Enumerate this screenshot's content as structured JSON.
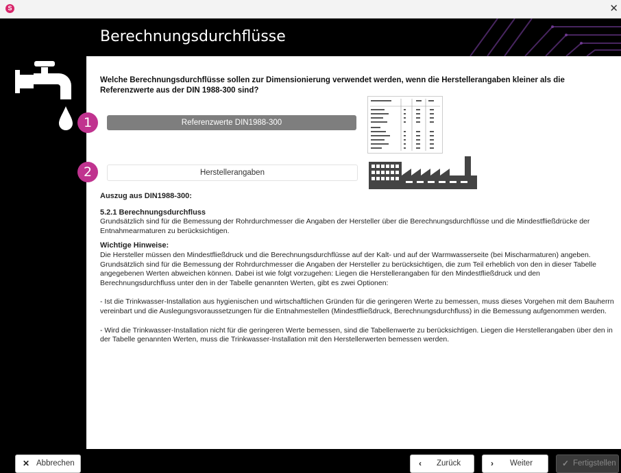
{
  "window": {
    "app_icon": "app-logo-icon",
    "close_icon": "close-icon"
  },
  "header": {
    "title": "Berechnungsdurchflüsse"
  },
  "main": {
    "question": "Welche Berechnungsdurchflüsse sollen zur Dimensionierung verwendet werden, wenn die Herstellerangaben kleiner als die Referenzwerte aus der DIN 1988-300 sind?",
    "options": [
      {
        "badge": "1",
        "label": "Referenzwerte DIN1988-300",
        "selected": true
      },
      {
        "badge": "2",
        "label": "Herstellerangaben",
        "selected": false
      }
    ],
    "excerpt": {
      "heading": "Auszug aus DIN1988-300:",
      "section_title": "5.2.1 Berechnungsdurchfluss",
      "section_text": "Grundsätzlich sind für die Bemessung der Rohrdurchmesser die Angaben der Hersteller über die Berechnungsdurchflüsse und die Mindestfließdrücke der Entnahmearmaturen zu berücksichtigen.",
      "notes_title": "Wichtige Hinweise:",
      "notes_text": "Die Hersteller müssen den Mindestfließdruck und die Berechnungsdurchflüsse auf der Kalt- und auf der Warmwasserseite (bei Mischarmaturen) angeben. Grundsätzlich sind für die Bemessung der Rohrdurchmesser die Angaben der Hersteller zu berücksichtigen, die zum Teil erheblich von den in dieser Tabelle angegebenen Werten abweichen können. Dabei ist wie folgt vorzugehen: Liegen die Herstellerangaben für den Mindestfließdruck und den Berechnungsdurchfluss unter den in der Tabelle genannten Werten, gibt es zwei Optionen:",
      "option_a": "- Ist die Trinkwasser-Installation aus hygienischen und wirtschaftlichen Gründen für die geringeren Werte zu bemessen, muss dieses Vorgehen mit dem Bauherrn vereinbart und die Auslegungsvoraussetzungen für die Entnahmestellen (Mindestfließdruck, Berechnungsdurchfluss) in die Bemessung aufgenommen werden.",
      "option_b": "- Wird die Trinkwasser-Installation nicht für die geringeren Werte bemessen, sind die Tabellenwerte zu berücksichtigen. Liegen die Herstellerangaben über den in der Tabelle genannten Werten, muss die Trinkwasser-Installation mit den Herstellerwerten bemessen werden."
    }
  },
  "footer": {
    "cancel_label": "Abbrechen",
    "back_label": "Zurück",
    "next_label": "Weiter",
    "finish_label": "Fertigstellen"
  }
}
